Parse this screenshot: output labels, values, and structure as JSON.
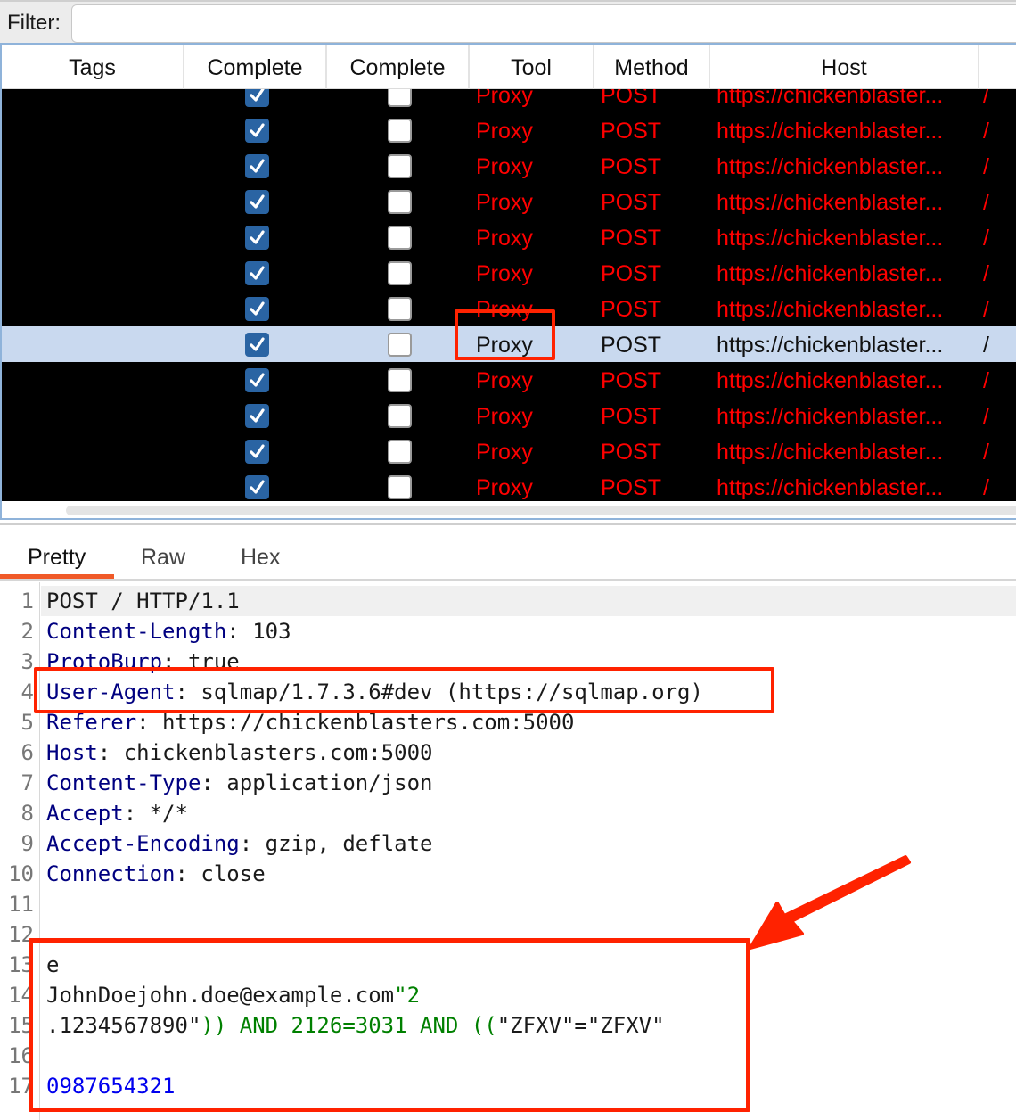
{
  "filter": {
    "label": "Filter:",
    "value": "",
    "placeholder": ""
  },
  "table": {
    "columns": [
      "Tags",
      "Complete",
      "Complete",
      "Tool",
      "Method",
      "Host"
    ],
    "rows": [
      {
        "complete1": true,
        "complete2": false,
        "tool": "Proxy",
        "method": "POST",
        "host": "https://chickenblaster...",
        "path": "/",
        "selected": false
      },
      {
        "complete1": true,
        "complete2": false,
        "tool": "Proxy",
        "method": "POST",
        "host": "https://chickenblaster...",
        "path": "/",
        "selected": false
      },
      {
        "complete1": true,
        "complete2": false,
        "tool": "Proxy",
        "method": "POST",
        "host": "https://chickenblaster...",
        "path": "/",
        "selected": false
      },
      {
        "complete1": true,
        "complete2": false,
        "tool": "Proxy",
        "method": "POST",
        "host": "https://chickenblaster...",
        "path": "/",
        "selected": false
      },
      {
        "complete1": true,
        "complete2": false,
        "tool": "Proxy",
        "method": "POST",
        "host": "https://chickenblaster...",
        "path": "/",
        "selected": false
      },
      {
        "complete1": true,
        "complete2": false,
        "tool": "Proxy",
        "method": "POST",
        "host": "https://chickenblaster...",
        "path": "/",
        "selected": false
      },
      {
        "complete1": true,
        "complete2": false,
        "tool": "Proxy",
        "method": "POST",
        "host": "https://chickenblaster...",
        "path": "/",
        "selected": false
      },
      {
        "complete1": true,
        "complete2": false,
        "tool": "Proxy",
        "method": "POST",
        "host": "https://chickenblaster...",
        "path": "/",
        "selected": true
      },
      {
        "complete1": true,
        "complete2": false,
        "tool": "Proxy",
        "method": "POST",
        "host": "https://chickenblaster...",
        "path": "/",
        "selected": false
      },
      {
        "complete1": true,
        "complete2": false,
        "tool": "Proxy",
        "method": "POST",
        "host": "https://chickenblaster...",
        "path": "/",
        "selected": false
      },
      {
        "complete1": true,
        "complete2": false,
        "tool": "Proxy",
        "method": "POST",
        "host": "https://chickenblaster...",
        "path": "/",
        "selected": false
      },
      {
        "complete1": true,
        "complete2": false,
        "tool": "Proxy",
        "method": "POST",
        "host": "https://chickenblaster...",
        "path": "/",
        "selected": false
      }
    ]
  },
  "tabs": [
    {
      "label": "Pretty",
      "active": true
    },
    {
      "label": "Raw",
      "active": false
    },
    {
      "label": "Hex",
      "active": false
    }
  ],
  "editor": {
    "lines": [
      {
        "n": "1",
        "parts": [
          {
            "t": "POST / HTTP/1.1",
            "c": ""
          }
        ]
      },
      {
        "n": "2",
        "parts": [
          {
            "t": "Content-Length",
            "c": "k"
          },
          {
            "t": ": 103",
            "c": ""
          }
        ]
      },
      {
        "n": "3",
        "parts": [
          {
            "t": "ProtoBurp",
            "c": "k"
          },
          {
            "t": ": true",
            "c": ""
          }
        ]
      },
      {
        "n": "4",
        "parts": [
          {
            "t": "User-Agent",
            "c": "k"
          },
          {
            "t": ": sqlmap/1.7.3.6#dev (https://sqlmap.org)",
            "c": ""
          }
        ]
      },
      {
        "n": "5",
        "parts": [
          {
            "t": "Referer",
            "c": "k"
          },
          {
            "t": ": https://chickenblasters.com:5000",
            "c": ""
          }
        ]
      },
      {
        "n": "6",
        "parts": [
          {
            "t": "Host",
            "c": "k"
          },
          {
            "t": ": chickenblasters.com:5000",
            "c": ""
          }
        ]
      },
      {
        "n": "7",
        "parts": [
          {
            "t": "Content-Type",
            "c": "k"
          },
          {
            "t": ": application/json",
            "c": ""
          }
        ]
      },
      {
        "n": "8",
        "parts": [
          {
            "t": "Accept",
            "c": "k"
          },
          {
            "t": ": */*",
            "c": ""
          }
        ]
      },
      {
        "n": "9",
        "parts": [
          {
            "t": "Accept-Encoding",
            "c": "k"
          },
          {
            "t": ": gzip, deflate",
            "c": ""
          }
        ]
      },
      {
        "n": "10",
        "parts": [
          {
            "t": "Connection",
            "c": "k"
          },
          {
            "t": ": close",
            "c": ""
          }
        ]
      },
      {
        "n": "11",
        "parts": []
      },
      {
        "n": "12",
        "parts": []
      },
      {
        "n": "13",
        "parts": [
          {
            "t": "e",
            "c": ""
          }
        ]
      },
      {
        "n": "14",
        "parts": [
          {
            "t": "JohnDoejohn.doe@example.com",
            "c": ""
          },
          {
            "t": "\"2",
            "c": "g"
          }
        ]
      },
      {
        "n": "15",
        "parts": [
          {
            "t": ".1234567890\"",
            "c": ""
          },
          {
            "t": ")) AND 2126=3031 AND ((",
            "c": "g"
          },
          {
            "t": "\"ZFXV\"=\"ZFXV\"",
            "c": ""
          }
        ]
      },
      {
        "n": "16",
        "parts": []
      },
      {
        "n": "17",
        "parts": [
          {
            "t": "0987654321",
            "c": "b"
          }
        ]
      }
    ]
  },
  "colors": {
    "row_text": "#ff0000",
    "selected_row_bg": "#c9d9ef",
    "checkbox_checked": "#2a64a3",
    "annotation": "#ff2200",
    "active_tab_underline": "#f05a28",
    "header_key": "#000080",
    "sql_payload": "#008000",
    "number_value": "#0000ee"
  }
}
